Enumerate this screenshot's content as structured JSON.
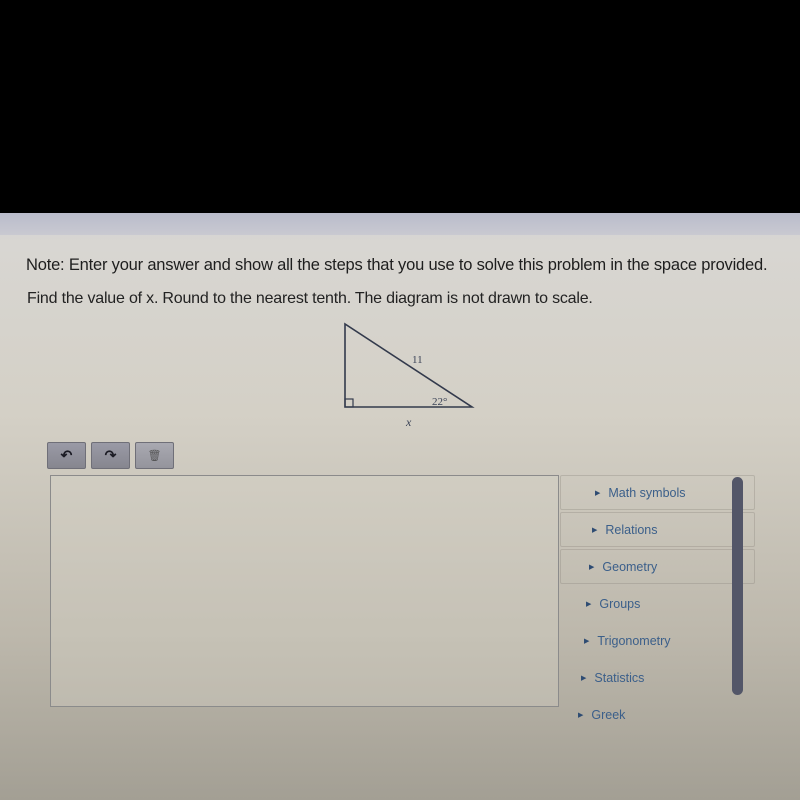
{
  "note": "Note: Enter your answer and show all the steps that you use to solve this problem in the space provided.",
  "question": "Find the value of x. Round to the nearest tenth. The diagram is not drawn to scale.",
  "diagram": {
    "hypotenuse_label": "11",
    "angle_label": "22°",
    "base_label": "x"
  },
  "toolbar": {
    "undo_icon": "↶",
    "redo_icon": "↷",
    "trash_icon": "🗑"
  },
  "editor": {
    "value": ""
  },
  "palette": {
    "items": [
      {
        "label": "Math symbols"
      },
      {
        "label": "Relations"
      },
      {
        "label": "Geometry"
      },
      {
        "label": "Groups"
      },
      {
        "label": "Trigonometry"
      },
      {
        "label": "Statistics"
      },
      {
        "label": "Greek"
      }
    ]
  }
}
